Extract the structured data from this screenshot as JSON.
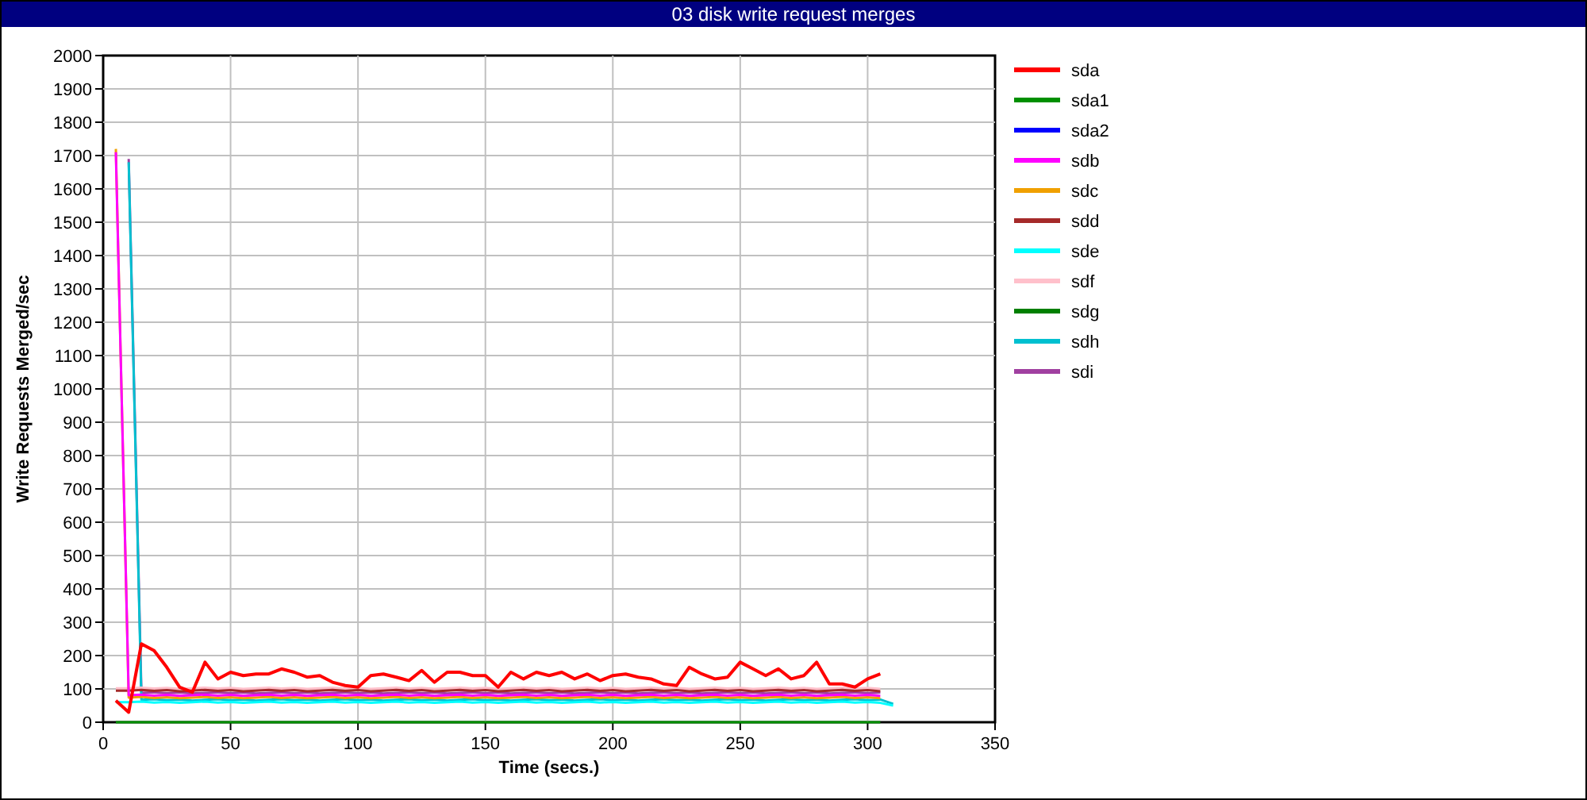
{
  "chart_data": {
    "type": "line",
    "title": "03 disk write request merges",
    "xlabel": "Time (secs.)",
    "ylabel": "Write Requests Merged/sec",
    "xlim": [
      0,
      350
    ],
    "ylim": [
      0,
      2000
    ],
    "grid": true,
    "legend": true,
    "xticks": [
      0,
      50,
      100,
      150,
      200,
      250,
      300,
      350
    ],
    "yticks": [
      0,
      100,
      200,
      300,
      400,
      500,
      600,
      700,
      800,
      900,
      1000,
      1100,
      1200,
      1300,
      1400,
      1500,
      1600,
      1700,
      1800,
      1900,
      2000
    ],
    "x": [
      5,
      10,
      15,
      20,
      25,
      30,
      35,
      40,
      45,
      50,
      55,
      60,
      65,
      70,
      75,
      80,
      85,
      90,
      95,
      100,
      105,
      110,
      115,
      120,
      125,
      130,
      135,
      140,
      145,
      150,
      155,
      160,
      165,
      170,
      175,
      180,
      185,
      190,
      195,
      200,
      205,
      210,
      215,
      220,
      225,
      230,
      235,
      240,
      245,
      250,
      255,
      260,
      265,
      270,
      275,
      280,
      285,
      290,
      295,
      300,
      305,
      310
    ],
    "series": [
      {
        "name": "sda",
        "color": "#ff0000",
        "values": [
          65,
          30,
          235,
          215,
          165,
          105,
          90,
          180,
          130,
          150,
          140,
          145,
          145,
          160,
          150,
          135,
          140,
          120,
          110,
          105,
          140,
          145,
          135,
          125,
          155,
          120,
          150,
          150,
          140,
          140,
          105,
          150,
          130,
          150,
          140,
          150,
          130,
          145,
          125,
          140,
          145,
          135,
          130,
          115,
          110,
          165,
          145,
          130,
          135,
          180,
          160,
          140,
          160,
          130,
          140,
          180,
          115,
          115,
          105,
          130,
          145,
          null
        ]
      },
      {
        "name": "sda1",
        "color": "#008f00",
        "values": [
          0,
          0,
          0,
          0,
          0,
          0,
          0,
          0,
          0,
          0,
          0,
          0,
          0,
          0,
          0,
          0,
          0,
          0,
          0,
          0,
          0,
          0,
          0,
          0,
          0,
          0,
          0,
          0,
          0,
          0,
          0,
          0,
          0,
          0,
          0,
          0,
          0,
          0,
          0,
          0,
          0,
          0,
          0,
          0,
          0,
          0,
          0,
          0,
          0,
          0,
          0,
          0,
          0,
          0,
          0,
          0,
          0,
          0,
          0,
          0,
          0,
          null
        ]
      },
      {
        "name": "sda2",
        "color": "#0000ff",
        "values": [
          null,
          null,
          null,
          null,
          null,
          null,
          null,
          null,
          null,
          null,
          null,
          null,
          null,
          null,
          null,
          null,
          null,
          null,
          null,
          null,
          null,
          null,
          null,
          null,
          null,
          null,
          null,
          null,
          null,
          null,
          null,
          null,
          null,
          null,
          null,
          null,
          null,
          null,
          null,
          null,
          null,
          null,
          null,
          null,
          null,
          null,
          null,
          null,
          null,
          null,
          null,
          null,
          null,
          null,
          null,
          null,
          null,
          null,
          null,
          null,
          null,
          null
        ]
      },
      {
        "name": "sdb",
        "color": "#ff00ff",
        "values": [
          1710,
          81,
          83,
          80,
          82,
          79,
          81,
          83,
          80,
          82,
          79,
          81,
          83,
          80,
          82,
          79,
          81,
          83,
          80,
          82,
          79,
          81,
          83,
          80,
          82,
          79,
          81,
          83,
          80,
          82,
          79,
          81,
          83,
          80,
          82,
          79,
          81,
          83,
          80,
          82,
          79,
          81,
          83,
          80,
          82,
          79,
          81,
          83,
          80,
          82,
          79,
          81,
          83,
          80,
          82,
          79,
          81,
          83,
          80,
          82,
          79,
          null
        ]
      },
      {
        "name": "sdc",
        "color": "#f0a000",
        "values": [
          1720,
          74,
          76,
          73,
          75,
          72,
          74,
          76,
          73,
          75,
          72,
          74,
          76,
          73,
          75,
          72,
          74,
          76,
          73,
          75,
          72,
          74,
          76,
          73,
          75,
          72,
          74,
          76,
          73,
          75,
          72,
          74,
          76,
          73,
          75,
          72,
          74,
          76,
          73,
          75,
          72,
          74,
          76,
          73,
          75,
          72,
          74,
          76,
          73,
          75,
          72,
          74,
          76,
          73,
          75,
          72,
          74,
          76,
          73,
          75,
          72,
          null
        ]
      },
      {
        "name": "sdd",
        "color": "#a52a2a",
        "values": [
          95,
          95,
          97,
          94,
          96,
          93,
          95,
          97,
          94,
          96,
          93,
          95,
          97,
          94,
          96,
          93,
          95,
          97,
          94,
          96,
          93,
          95,
          97,
          94,
          96,
          93,
          95,
          97,
          94,
          96,
          93,
          95,
          97,
          94,
          96,
          93,
          95,
          97,
          94,
          96,
          93,
          95,
          97,
          94,
          96,
          93,
          95,
          97,
          94,
          96,
          93,
          95,
          97,
          94,
          96,
          93,
          95,
          97,
          94,
          96,
          93,
          null
        ]
      },
      {
        "name": "sde",
        "color": "#00ffff",
        "values": [
          60,
          60,
          62,
          59,
          61,
          58,
          60,
          62,
          59,
          61,
          58,
          60,
          62,
          59,
          61,
          58,
          60,
          62,
          59,
          61,
          58,
          60,
          62,
          59,
          61,
          58,
          60,
          62,
          59,
          61,
          58,
          60,
          62,
          59,
          61,
          58,
          60,
          62,
          59,
          61,
          58,
          60,
          62,
          59,
          61,
          58,
          60,
          62,
          59,
          61,
          58,
          60,
          62,
          59,
          61,
          58,
          60,
          62,
          59,
          61,
          58,
          50
        ]
      },
      {
        "name": "sdf",
        "color": "#ffc0cb",
        "values": [
          102,
          102,
          104,
          101,
          103,
          100,
          102,
          104,
          101,
          103,
          100,
          102,
          104,
          101,
          103,
          100,
          102,
          104,
          101,
          103,
          100,
          102,
          104,
          101,
          103,
          100,
          102,
          104,
          101,
          103,
          100,
          102,
          104,
          101,
          103,
          100,
          102,
          104,
          101,
          103,
          100,
          102,
          104,
          101,
          103,
          100,
          102,
          104,
          101,
          103,
          100,
          102,
          104,
          101,
          103,
          100,
          102,
          104,
          101,
          103,
          100,
          null
        ]
      },
      {
        "name": "sdg",
        "color": "#007f00",
        "values": [
          null,
          null,
          null,
          null,
          null,
          null,
          null,
          null,
          null,
          null,
          null,
          null,
          null,
          null,
          null,
          null,
          null,
          null,
          null,
          null,
          null,
          null,
          null,
          null,
          null,
          null,
          null,
          null,
          null,
          null,
          null,
          null,
          null,
          null,
          null,
          null,
          null,
          null,
          null,
          null,
          null,
          null,
          null,
          null,
          null,
          null,
          null,
          null,
          null,
          null,
          null,
          null,
          null,
          null,
          null,
          null,
          null,
          null,
          null,
          null,
          null,
          null
        ]
      },
      {
        "name": "sdh",
        "color": "#00c0d0",
        "values": [
          null,
          1680,
          67,
          69,
          66,
          68,
          65,
          67,
          69,
          66,
          68,
          65,
          67,
          69,
          66,
          68,
          65,
          67,
          69,
          66,
          68,
          65,
          67,
          69,
          66,
          68,
          65,
          67,
          69,
          66,
          68,
          65,
          67,
          69,
          66,
          68,
          65,
          67,
          69,
          66,
          68,
          65,
          67,
          69,
          66,
          68,
          65,
          67,
          69,
          66,
          68,
          65,
          67,
          69,
          66,
          68,
          65,
          67,
          69,
          66,
          68,
          55
        ]
      },
      {
        "name": "sdi",
        "color": "#a040a0",
        "values": [
          null,
          1690,
          88,
          90,
          87,
          89,
          86,
          88,
          90,
          87,
          89,
          86,
          88,
          90,
          87,
          89,
          86,
          88,
          90,
          87,
          89,
          86,
          88,
          90,
          87,
          89,
          86,
          88,
          90,
          87,
          89,
          86,
          88,
          90,
          87,
          89,
          86,
          88,
          90,
          87,
          89,
          86,
          88,
          90,
          87,
          89,
          86,
          88,
          90,
          87,
          89,
          86,
          88,
          90,
          87,
          89,
          86,
          88,
          90,
          87,
          89,
          null
        ]
      }
    ]
  }
}
